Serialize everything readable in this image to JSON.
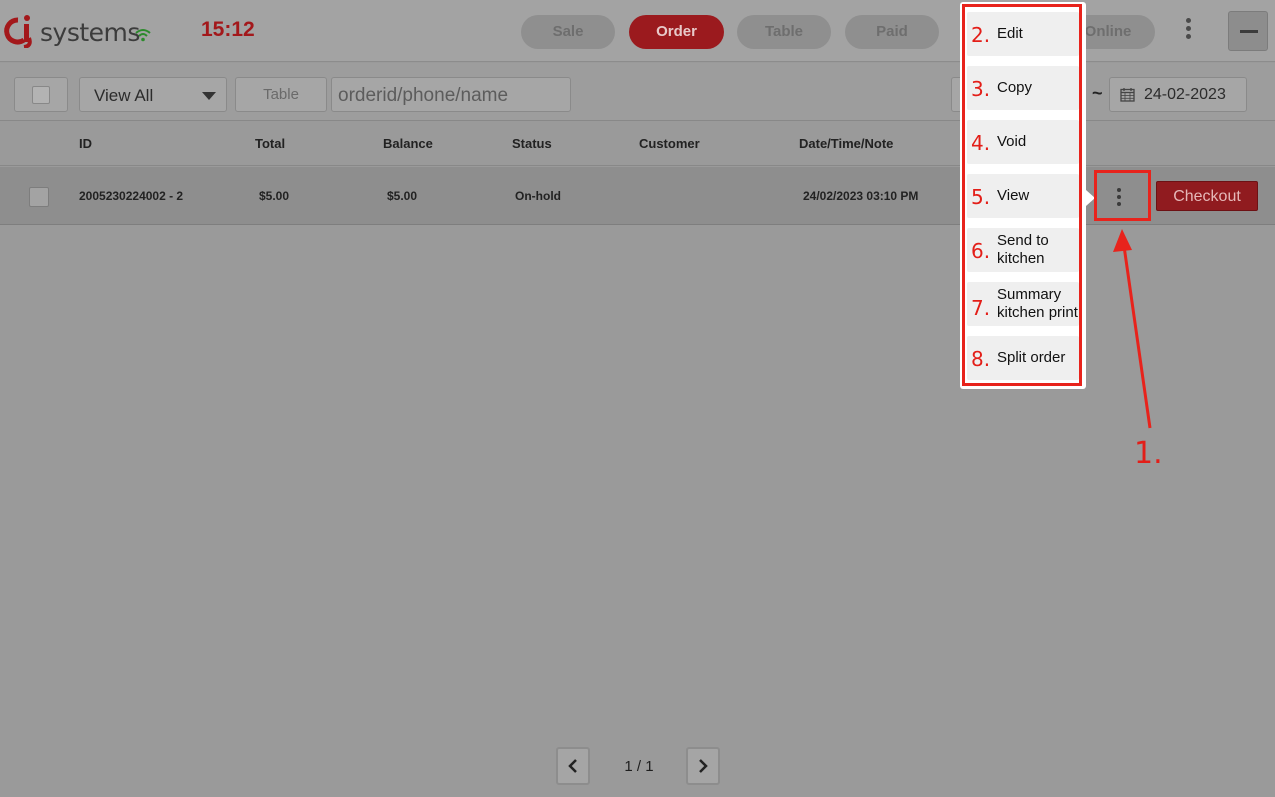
{
  "header": {
    "logo_text": "systems",
    "clock": "15:12",
    "nav": [
      "Sale",
      "Order",
      "Table",
      "Paid",
      "Online"
    ],
    "active_nav": "Order",
    "brand_color": "#a3181b"
  },
  "filters": {
    "view_select": "View All",
    "table_button": "Table",
    "search_placeholder": "orderid/phone/name",
    "range_separator": "~",
    "date_to": "24-02-2023"
  },
  "table": {
    "columns": [
      "ID",
      "Total",
      "Balance",
      "Status",
      "Customer",
      "Date/Time/Note"
    ],
    "rows": [
      {
        "id": "2005230224002 - 2",
        "total": "$5.00",
        "balance": "$5.00",
        "status": "On-hold",
        "customer": "",
        "datetime": "24/02/2023 03:10 PM",
        "action": "Checkout"
      }
    ]
  },
  "pagination": {
    "info": "1 / 1"
  },
  "menu": {
    "items": [
      {
        "num": "2.",
        "label": "Edit"
      },
      {
        "num": "3.",
        "label": "Copy"
      },
      {
        "num": "4.",
        "label": "Void"
      },
      {
        "num": "5.",
        "label": "View"
      },
      {
        "num": "6.",
        "label": "Send to kitchen"
      },
      {
        "num": "7.",
        "label": "Summary kitchen print"
      },
      {
        "num": "8.",
        "label": "Split order"
      }
    ]
  },
  "annotation": {
    "label": "1.",
    "color": "#e8231c"
  }
}
